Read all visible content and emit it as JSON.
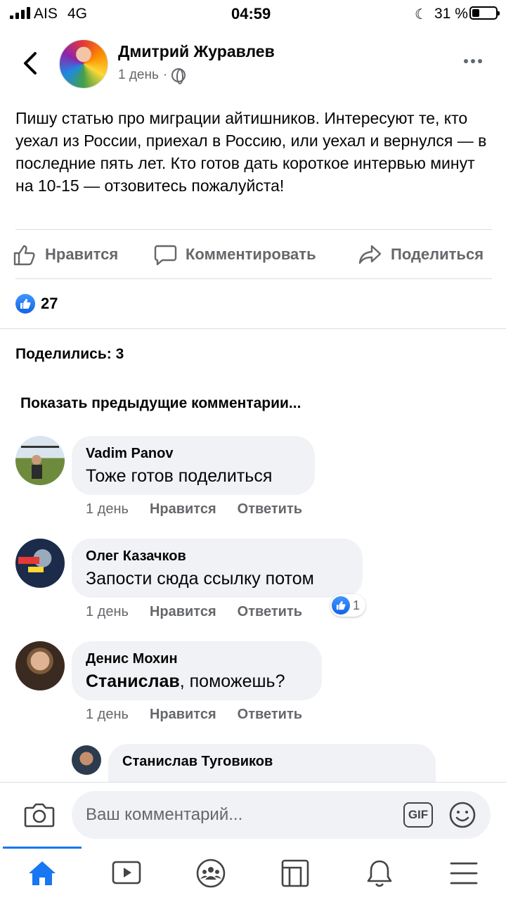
{
  "status_bar": {
    "carrier": "AIS",
    "network": "4G",
    "time": "04:59",
    "battery_percent": "31 %",
    "battery_level": 0.31
  },
  "post": {
    "author": "Дмитрий Журавлев",
    "time": "1 день",
    "separator": "·",
    "privacy_icon": "globe-icon",
    "text": "Пишу статью про миграции айтишников. Интересуют те, кто уехал из России, приехал в Россию, или уехал и вернулся — в последние пять лет. Кто готов дать короткое интервью минут на 10-15 — отзовитесь пожалуйста!",
    "actions": {
      "like": "Нравится",
      "comment": "Комментировать",
      "share": "Поделиться"
    },
    "reactions_count": "27",
    "shares_label": "Поделились: 3",
    "show_previous": "Показать предыдущие комментарии..."
  },
  "comments": [
    {
      "name": "Vadim Panov",
      "text": "Тоже готов поделиться",
      "time": "1 день",
      "like": "Нравится",
      "reply": "Ответить"
    },
    {
      "name": "Олег Казачков",
      "text": "Запости сюда ссылку потом",
      "time": "1 день",
      "like": "Нравится",
      "reply": "Ответить",
      "reactions": "1"
    },
    {
      "name": "Денис Мохин",
      "mention": "Станислав",
      "text": ", поможешь?",
      "time": "1 день",
      "like": "Нравится",
      "reply": "Ответить"
    }
  ],
  "reply": {
    "name": "Станислав Туговиков"
  },
  "composer": {
    "placeholder": "Ваш комментарий...",
    "gif_label": "GIF"
  },
  "colors": {
    "accent": "#1877f2",
    "secondary_text": "#65676b",
    "bubble": "#f0f2f5"
  }
}
